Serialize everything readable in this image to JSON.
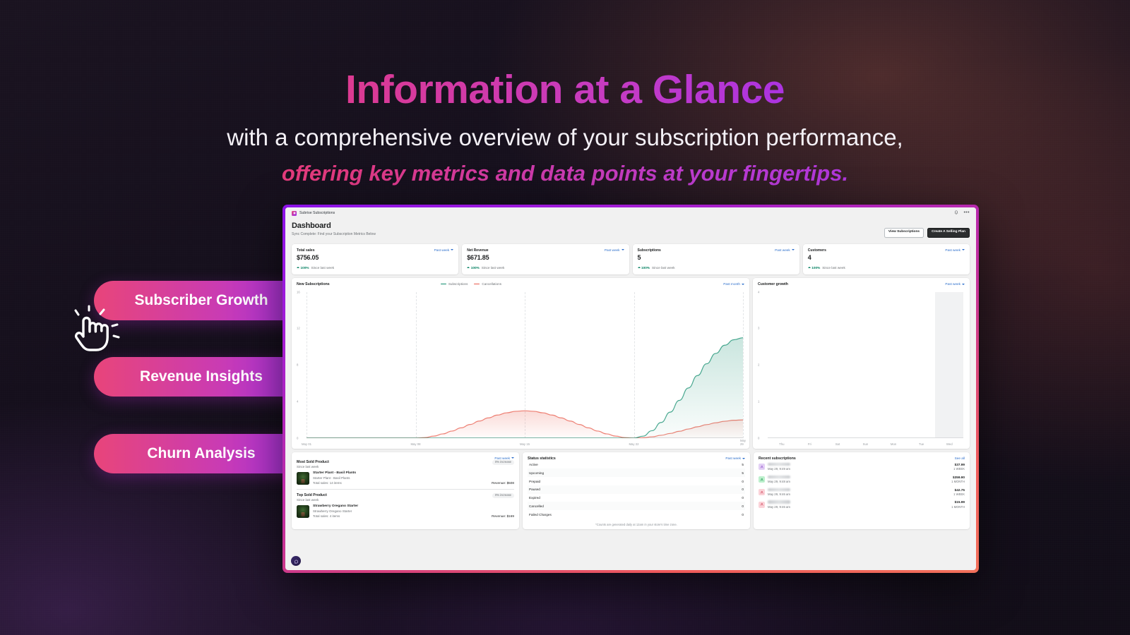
{
  "hero": {
    "headline": "Information at a Glance",
    "line2": "with a comprehensive overview of your subscription performance,",
    "line3": "offering key metrics and data points at your fingertips."
  },
  "pills": [
    {
      "label": "Subscriber Growth"
    },
    {
      "label": "Revenue Insights"
    },
    {
      "label": "Churn Analysis"
    }
  ],
  "app": {
    "brand": "Subrise Subscriptions",
    "topbar": {
      "bell_icon": "bell-icon",
      "more_icon": "more-horizontal-icon"
    },
    "page_title": "Dashboard",
    "page_subtitle": "Sync Complete: Find your Subscription Metrics Below",
    "actions": {
      "view_subscriptions": "View Subscriptions",
      "create_selling_plan": "Create A Selling Plan"
    },
    "metrics": [
      {
        "label": "Total sales",
        "value": "$756.05",
        "range": "Past week",
        "delta": "100%",
        "delta_note": "Since last week"
      },
      {
        "label": "Net Revenue",
        "value": "$671.85",
        "range": "Past week",
        "delta": "100%",
        "delta_note": "Since last week"
      },
      {
        "label": "Subscriptions",
        "value": "5",
        "range": "Past week",
        "delta": "100%",
        "delta_note": "Since last week"
      },
      {
        "label": "Customers",
        "value": "4",
        "range": "Past week",
        "delta": "100%",
        "delta_note": "Since last week"
      }
    ],
    "new_subscriptions": {
      "title": "New Subscriptions",
      "range": "Past month",
      "legend": [
        {
          "name": "Subscriptions",
          "color": "#0f8c6c"
        },
        {
          "name": "Cancellations",
          "color": "#e8594a"
        }
      ]
    },
    "customer_growth": {
      "title": "Customer growth",
      "range": "Past week"
    },
    "products": {
      "range": "Past week",
      "sections": [
        {
          "title": "Most Sold Product",
          "subtitle": "Since last week",
          "badge": "0% increase",
          "name": "Starter Plant - Basil Plants",
          "description": "Starter Plant - Basil Plants",
          "sales": "Total sales: 14 items",
          "revenue_label": "Revenue:",
          "revenue": "$508"
        },
        {
          "title": "Top Sold Product",
          "subtitle": "Since last week",
          "badge": "0% increase",
          "name": "Strawberry Oregano Starter",
          "description": "Strawberry Oregano Starter",
          "sales": "Total sales: 4 items",
          "revenue_label": "Revenue:",
          "revenue": "$169"
        }
      ]
    },
    "status_statistics": {
      "title": "Status statistics",
      "range": "Past week",
      "rows": [
        {
          "name": "Active",
          "value": "5"
        },
        {
          "name": "Upcoming",
          "value": "5"
        },
        {
          "name": "Prepaid",
          "value": "0"
        },
        {
          "name": "Paused",
          "value": "0"
        },
        {
          "name": "Expired",
          "value": "0"
        },
        {
          "name": "Cancelled",
          "value": "0"
        },
        {
          "name": "Failed Charges",
          "value": "0"
        }
      ],
      "footnote": "*Counts are generated daily at 12am in your store's time zone."
    },
    "recent_subscriptions": {
      "title": "Recent subscriptions",
      "see_all": "See all",
      "rows": [
        {
          "name": "",
          "date": "May 29, 9:49 am",
          "amount": "$37.99",
          "interval": "1 WEEK",
          "avatar_color": "#e3d0f5",
          "icon_color": "#9b5fd0"
        },
        {
          "name": "",
          "date": "May 29, 9:48 am",
          "amount": "$359.90",
          "interval": "1 MONTH",
          "avatar_color": "#bdf0cd",
          "icon_color": "#2f9e5e"
        },
        {
          "name": "",
          "date": "May 29, 9:46 am",
          "amount": "$42.75",
          "interval": "1 WEEK",
          "avatar_color": "#fbd2d8",
          "icon_color": "#d4566b"
        },
        {
          "name": "",
          "date": "May 29, 9:46 am",
          "amount": "$15.99",
          "interval": "1 MONTH",
          "avatar_color": "#fbd2d8",
          "icon_color": "#d4566b"
        }
      ]
    },
    "fab_icon": "chat-bubble-icon"
  },
  "chart_data": [
    {
      "type": "area",
      "title": "New Subscriptions",
      "xlabel": "",
      "ylabel": "",
      "ylim": [
        0,
        16
      ],
      "yticks": [
        0,
        4,
        8,
        12,
        16
      ],
      "x": [
        "May 01",
        "May 08",
        "May 15",
        "May 22",
        "May 29"
      ],
      "grid": true,
      "legend": "top-center",
      "series": [
        {
          "name": "Subscriptions",
          "color": "#0f8c6c",
          "x": [
            "May 01",
            "May 08",
            "May 15",
            "May 22",
            "May 29"
          ],
          "values": [
            0,
            0,
            0,
            0,
            11
          ]
        },
        {
          "name": "Cancellations",
          "color": "#e8594a",
          "x": [
            "May 01",
            "May 08",
            "May 15",
            "May 22",
            "May 29"
          ],
          "values": [
            0,
            0,
            3,
            0,
            2
          ]
        }
      ]
    },
    {
      "type": "bar",
      "title": "Customer growth",
      "xlabel": "",
      "ylabel": "",
      "ylim": [
        0,
        4
      ],
      "yticks": [
        0,
        1,
        2,
        3,
        4
      ],
      "categories": [
        "Thu",
        "Fri",
        "Sat",
        "Sun",
        "Mon",
        "Tue",
        "Wed"
      ],
      "values": [
        0,
        0,
        0,
        0,
        0,
        0,
        0
      ],
      "highlighted_category": "Wed",
      "grid": false
    }
  ]
}
